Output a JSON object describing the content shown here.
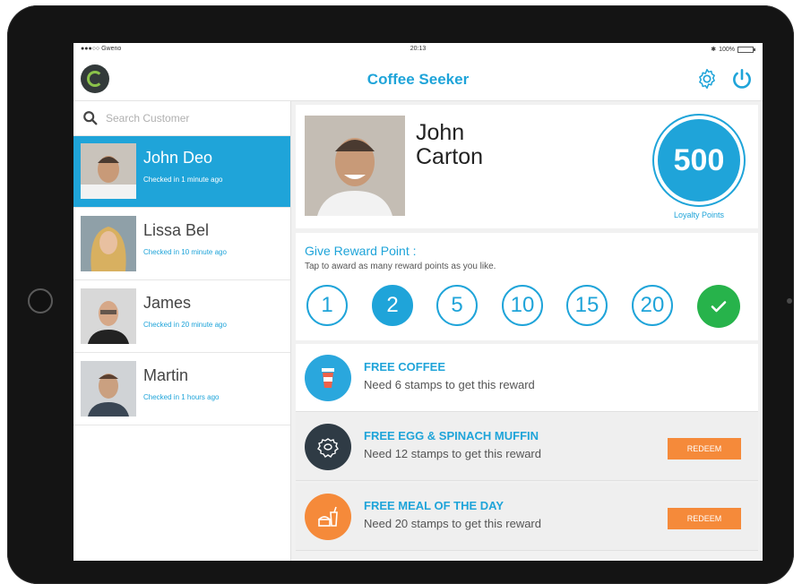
{
  "status_bar": {
    "carrier": "●●●○○ Gweno",
    "time": "20:13",
    "battery": "100%"
  },
  "header": {
    "title": "Coffee Seeker"
  },
  "search": {
    "placeholder": "Search Customer"
  },
  "customers": [
    {
      "name": "John Deo",
      "checked_in": "Checked in 1 minute ago",
      "active": true
    },
    {
      "name": "Lissa Bel",
      "checked_in": "Checked in 10 minute ago",
      "active": false
    },
    {
      "name": "James",
      "checked_in": "Checked in 20 minute ago",
      "active": false
    },
    {
      "name": "Martin",
      "checked_in": "Checked in 1 hours ago",
      "active": false
    }
  ],
  "profile": {
    "first_name": "John",
    "last_name": "Carton",
    "points": "500",
    "points_label": "Loyalty Points"
  },
  "reward_points": {
    "title": "Give Reward Point :",
    "subtitle": "Tap to award as many reward points as you like.",
    "options": [
      "1",
      "2",
      "5",
      "10",
      "15",
      "20"
    ],
    "selected": "2"
  },
  "rewards": [
    {
      "title": "FREE COFFEE",
      "subtitle": "Need 6 stamps to get this reward",
      "icon": "coffee-cup-icon",
      "icon_color": "#2aa7dd",
      "redeem": ""
    },
    {
      "title": "FREE EGG & SPINACH MUFFIN",
      "subtitle": "Need 12 stamps to get this reward",
      "icon": "muffin-icon",
      "icon_color": "#2f3b45",
      "redeem": "REDEEM"
    },
    {
      "title": "FREE MEAL OF THE DAY",
      "subtitle": "Need 20 stamps to get this reward",
      "icon": "meal-icon",
      "icon_color": "#f58a3a",
      "redeem": "REDEEM"
    }
  ],
  "colors": {
    "accent": "#1fa4d9",
    "confirm": "#27b34b",
    "redeem": "#f58a3a"
  }
}
